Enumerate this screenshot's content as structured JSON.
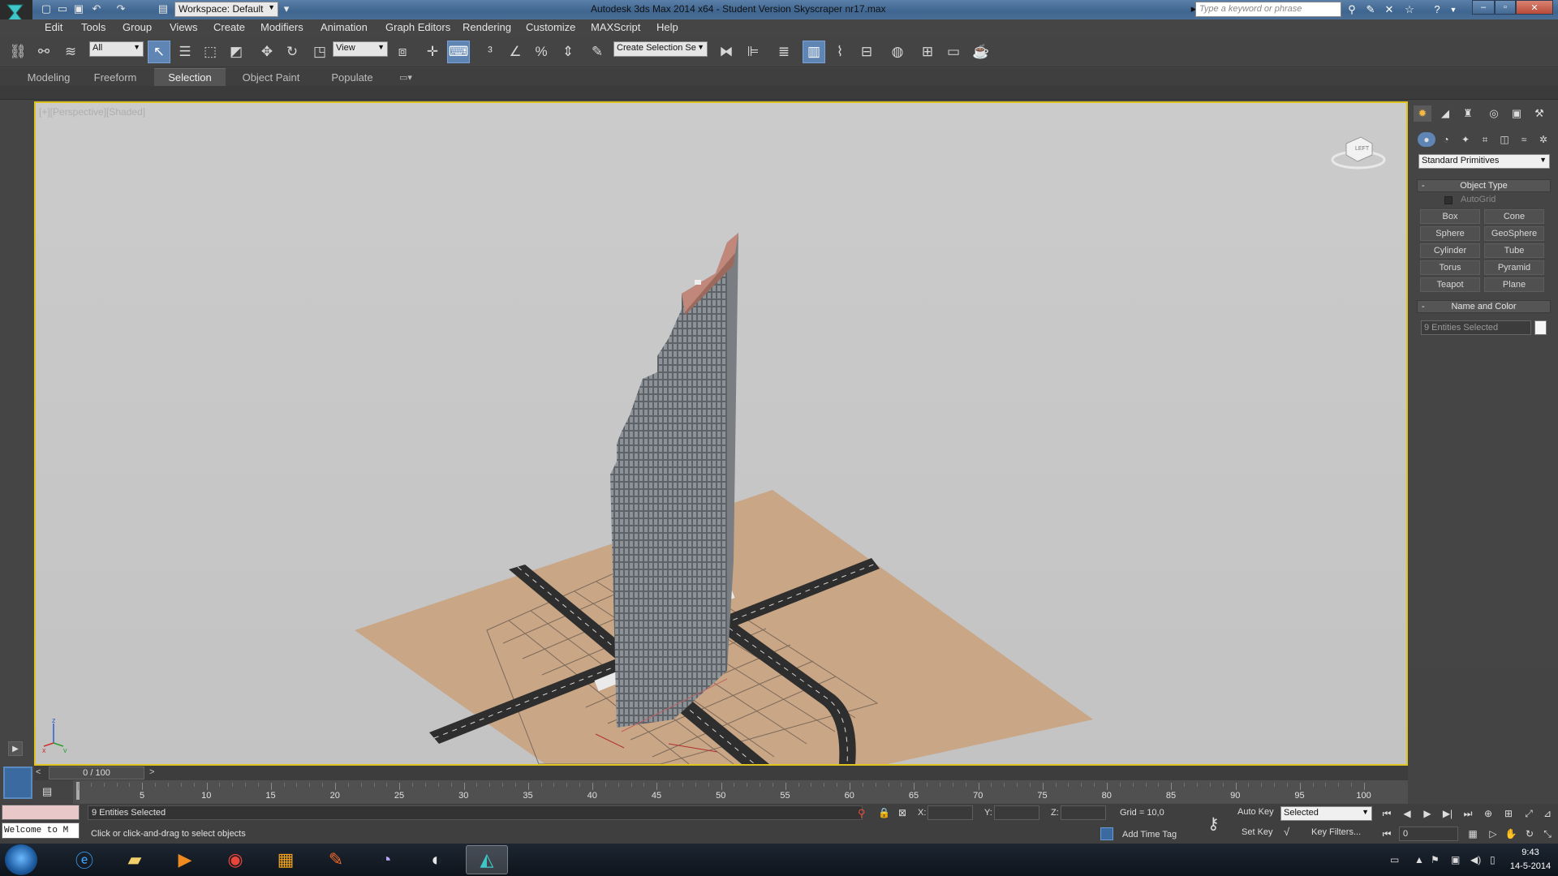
{
  "titlebar": {
    "workspace": "Workspace: Default",
    "title": "Autodesk 3ds Max  2014 x64  - Student Version    Skyscraper nr17.max",
    "search_placeholder": "Type a keyword or phrase"
  },
  "menu": [
    "Edit",
    "Tools",
    "Group",
    "Views",
    "Create",
    "Modifiers",
    "Animation",
    "Graph Editors",
    "Rendering",
    "Customize",
    "MAXScript",
    "Help"
  ],
  "toolbar": {
    "selection_filter": "All",
    "ref_coord": "View",
    "named_selection": "Create Selection Se"
  },
  "ribbon_tabs": [
    "Modeling",
    "Freeform",
    "Selection",
    "Object Paint",
    "Populate"
  ],
  "viewport": {
    "label": "[+][Perspective][Shaded]",
    "viewcube": "LEFT",
    "axis_x": "x",
    "axis_y": "y",
    "axis_z": "z"
  },
  "command_panel": {
    "category": "Standard Primitives",
    "object_type_title": "Object Type",
    "autogrid": "AutoGrid",
    "buttons": [
      "Box",
      "Cone",
      "Sphere",
      "GeoSphere",
      "Cylinder",
      "Tube",
      "Torus",
      "Pyramid",
      "Teapot",
      "Plane"
    ],
    "name_color_title": "Name and Color",
    "name_value": "9 Entities Selected"
  },
  "timeline": {
    "slider": "0 / 100",
    "ticks": [
      "5",
      "10",
      "15",
      "20",
      "25",
      "30",
      "35",
      "40",
      "45",
      "50",
      "55",
      "60",
      "65",
      "70",
      "75",
      "80",
      "85",
      "90",
      "95",
      "100"
    ]
  },
  "status": {
    "maxscript": "Welcome to M",
    "selection": "9 Entities Selected",
    "prompt": "Click or click-and-drag to select objects",
    "x_label": "X:",
    "y_label": "Y:",
    "z_label": "Z:",
    "grid": "Grid = 10,0",
    "add_time_tag": "Add Time Tag",
    "auto_key": "Auto Key",
    "set_key": "Set Key",
    "key_mode": "Selected",
    "key_filters": "Key Filters...",
    "frame": "0"
  },
  "taskbar": {
    "time": "9:43",
    "date": "14-5-2014"
  },
  "colors": {
    "viewport_bg": "#c8c8c8",
    "active_viewport_border": "#e0c41e",
    "ground": "#c9a686",
    "building_glass": "#6a6e72",
    "building_top": "#b98471"
  }
}
